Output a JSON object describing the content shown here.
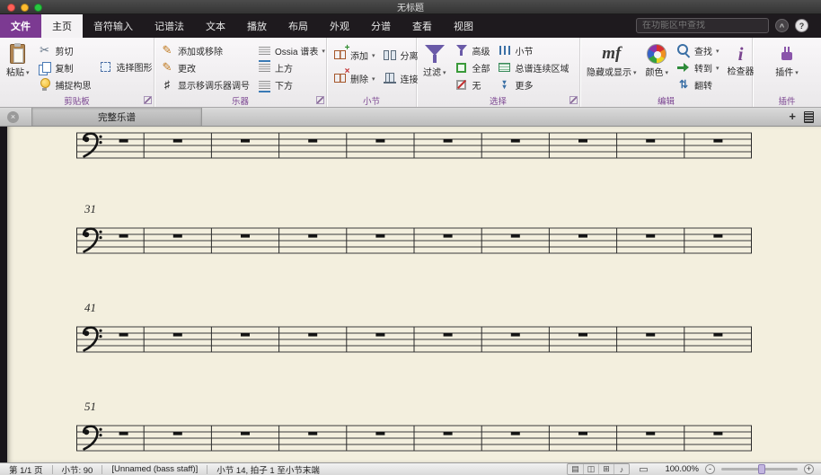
{
  "window": {
    "title": "无标题"
  },
  "ribbon": {
    "search": {
      "placeholder": "在功能区中查找"
    },
    "tabs": [
      {
        "label": "文件"
      },
      {
        "label": "主页"
      },
      {
        "label": "音符输入"
      },
      {
        "label": "记谱法"
      },
      {
        "label": "文本"
      },
      {
        "label": "播放"
      },
      {
        "label": "布局"
      },
      {
        "label": "外观"
      },
      {
        "label": "分谱"
      },
      {
        "label": "查看"
      },
      {
        "label": "视图"
      }
    ],
    "clipboard": {
      "label": "剪贴板",
      "paste": "粘贴",
      "cut": "剪切",
      "copy": "复制",
      "capture_idea": "捕捉构思",
      "select_graphic": "选择图形"
    },
    "instruments": {
      "label": "乐器",
      "add_or_remove": "添加或移除",
      "change": "更改",
      "show_transposing": "显示移调乐器调号",
      "ossia": "Ossia 谱表",
      "above": "上方",
      "below": "下方"
    },
    "bars": {
      "label": "小节",
      "add": "添加",
      "remove": "删除",
      "split": "分离",
      "join": "连接"
    },
    "select": {
      "label": "选择",
      "filter": "过滤",
      "advanced": "高级",
      "all": "全部",
      "none": "无",
      "bars": "小节",
      "passage": "总谱连续区域",
      "more": "更多"
    },
    "edit": {
      "label": "编辑",
      "hide_show": "隐藏或显示",
      "color": "颜色",
      "find": "查找",
      "goto": "转到",
      "flip": "翻转",
      "inspector": "检查器"
    },
    "plugins": {
      "label": "插件",
      "plugins_btn": "插件"
    }
  },
  "document_tabs": {
    "active": "完整乐谱"
  },
  "score": {
    "clef": "bass",
    "paper_color": "#f3efde",
    "systems": [
      {
        "number": "",
        "bars": 10
      },
      {
        "number": "31",
        "bars": 10
      },
      {
        "number": "41",
        "bars": 10
      },
      {
        "number": "51",
        "bars": 10
      }
    ]
  },
  "status_bar": {
    "page": "第 1/1 页",
    "bar_count": "小节: 90",
    "staff_name": "[Unnamed (bass staff)]",
    "selection": "小节 14, 拍子 1 至小节末端",
    "zoom_level": "100.00%"
  }
}
